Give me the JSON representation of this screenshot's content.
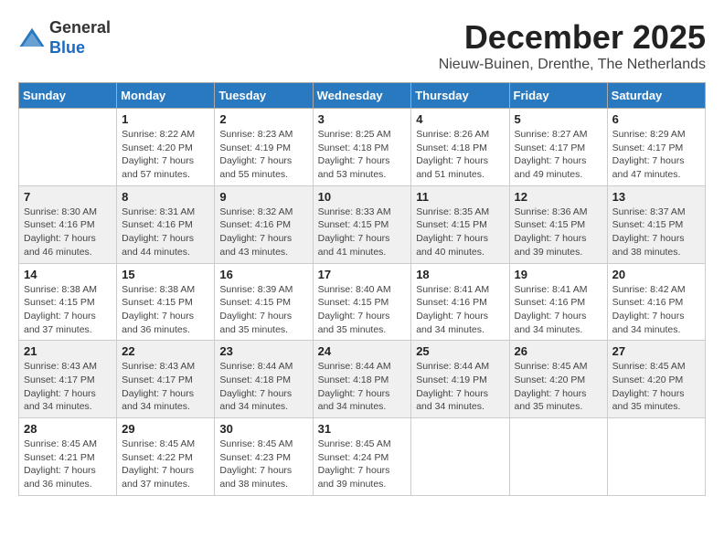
{
  "header": {
    "logo_line1": "General",
    "logo_line2": "Blue",
    "month": "December 2025",
    "location": "Nieuw-Buinen, Drenthe, The Netherlands"
  },
  "weekdays": [
    "Sunday",
    "Monday",
    "Tuesday",
    "Wednesday",
    "Thursday",
    "Friday",
    "Saturday"
  ],
  "weeks": [
    [
      {
        "day": "",
        "sunrise": "",
        "sunset": "",
        "daylight": ""
      },
      {
        "day": "1",
        "sunrise": "Sunrise: 8:22 AM",
        "sunset": "Sunset: 4:20 PM",
        "daylight": "Daylight: 7 hours and 57 minutes."
      },
      {
        "day": "2",
        "sunrise": "Sunrise: 8:23 AM",
        "sunset": "Sunset: 4:19 PM",
        "daylight": "Daylight: 7 hours and 55 minutes."
      },
      {
        "day": "3",
        "sunrise": "Sunrise: 8:25 AM",
        "sunset": "Sunset: 4:18 PM",
        "daylight": "Daylight: 7 hours and 53 minutes."
      },
      {
        "day": "4",
        "sunrise": "Sunrise: 8:26 AM",
        "sunset": "Sunset: 4:18 PM",
        "daylight": "Daylight: 7 hours and 51 minutes."
      },
      {
        "day": "5",
        "sunrise": "Sunrise: 8:27 AM",
        "sunset": "Sunset: 4:17 PM",
        "daylight": "Daylight: 7 hours and 49 minutes."
      },
      {
        "day": "6",
        "sunrise": "Sunrise: 8:29 AM",
        "sunset": "Sunset: 4:17 PM",
        "daylight": "Daylight: 7 hours and 47 minutes."
      }
    ],
    [
      {
        "day": "7",
        "sunrise": "Sunrise: 8:30 AM",
        "sunset": "Sunset: 4:16 PM",
        "daylight": "Daylight: 7 hours and 46 minutes."
      },
      {
        "day": "8",
        "sunrise": "Sunrise: 8:31 AM",
        "sunset": "Sunset: 4:16 PM",
        "daylight": "Daylight: 7 hours and 44 minutes."
      },
      {
        "day": "9",
        "sunrise": "Sunrise: 8:32 AM",
        "sunset": "Sunset: 4:16 PM",
        "daylight": "Daylight: 7 hours and 43 minutes."
      },
      {
        "day": "10",
        "sunrise": "Sunrise: 8:33 AM",
        "sunset": "Sunset: 4:15 PM",
        "daylight": "Daylight: 7 hours and 41 minutes."
      },
      {
        "day": "11",
        "sunrise": "Sunrise: 8:35 AM",
        "sunset": "Sunset: 4:15 PM",
        "daylight": "Daylight: 7 hours and 40 minutes."
      },
      {
        "day": "12",
        "sunrise": "Sunrise: 8:36 AM",
        "sunset": "Sunset: 4:15 PM",
        "daylight": "Daylight: 7 hours and 39 minutes."
      },
      {
        "day": "13",
        "sunrise": "Sunrise: 8:37 AM",
        "sunset": "Sunset: 4:15 PM",
        "daylight": "Daylight: 7 hours and 38 minutes."
      }
    ],
    [
      {
        "day": "14",
        "sunrise": "Sunrise: 8:38 AM",
        "sunset": "Sunset: 4:15 PM",
        "daylight": "Daylight: 7 hours and 37 minutes."
      },
      {
        "day": "15",
        "sunrise": "Sunrise: 8:38 AM",
        "sunset": "Sunset: 4:15 PM",
        "daylight": "Daylight: 7 hours and 36 minutes."
      },
      {
        "day": "16",
        "sunrise": "Sunrise: 8:39 AM",
        "sunset": "Sunset: 4:15 PM",
        "daylight": "Daylight: 7 hours and 35 minutes."
      },
      {
        "day": "17",
        "sunrise": "Sunrise: 8:40 AM",
        "sunset": "Sunset: 4:15 PM",
        "daylight": "Daylight: 7 hours and 35 minutes."
      },
      {
        "day": "18",
        "sunrise": "Sunrise: 8:41 AM",
        "sunset": "Sunset: 4:16 PM",
        "daylight": "Daylight: 7 hours and 34 minutes."
      },
      {
        "day": "19",
        "sunrise": "Sunrise: 8:41 AM",
        "sunset": "Sunset: 4:16 PM",
        "daylight": "Daylight: 7 hours and 34 minutes."
      },
      {
        "day": "20",
        "sunrise": "Sunrise: 8:42 AM",
        "sunset": "Sunset: 4:16 PM",
        "daylight": "Daylight: 7 hours and 34 minutes."
      }
    ],
    [
      {
        "day": "21",
        "sunrise": "Sunrise: 8:43 AM",
        "sunset": "Sunset: 4:17 PM",
        "daylight": "Daylight: 7 hours and 34 minutes."
      },
      {
        "day": "22",
        "sunrise": "Sunrise: 8:43 AM",
        "sunset": "Sunset: 4:17 PM",
        "daylight": "Daylight: 7 hours and 34 minutes."
      },
      {
        "day": "23",
        "sunrise": "Sunrise: 8:44 AM",
        "sunset": "Sunset: 4:18 PM",
        "daylight": "Daylight: 7 hours and 34 minutes."
      },
      {
        "day": "24",
        "sunrise": "Sunrise: 8:44 AM",
        "sunset": "Sunset: 4:18 PM",
        "daylight": "Daylight: 7 hours and 34 minutes."
      },
      {
        "day": "25",
        "sunrise": "Sunrise: 8:44 AM",
        "sunset": "Sunset: 4:19 PM",
        "daylight": "Daylight: 7 hours and 34 minutes."
      },
      {
        "day": "26",
        "sunrise": "Sunrise: 8:45 AM",
        "sunset": "Sunset: 4:20 PM",
        "daylight": "Daylight: 7 hours and 35 minutes."
      },
      {
        "day": "27",
        "sunrise": "Sunrise: 8:45 AM",
        "sunset": "Sunset: 4:20 PM",
        "daylight": "Daylight: 7 hours and 35 minutes."
      }
    ],
    [
      {
        "day": "28",
        "sunrise": "Sunrise: 8:45 AM",
        "sunset": "Sunset: 4:21 PM",
        "daylight": "Daylight: 7 hours and 36 minutes."
      },
      {
        "day": "29",
        "sunrise": "Sunrise: 8:45 AM",
        "sunset": "Sunset: 4:22 PM",
        "daylight": "Daylight: 7 hours and 37 minutes."
      },
      {
        "day": "30",
        "sunrise": "Sunrise: 8:45 AM",
        "sunset": "Sunset: 4:23 PM",
        "daylight": "Daylight: 7 hours and 38 minutes."
      },
      {
        "day": "31",
        "sunrise": "Sunrise: 8:45 AM",
        "sunset": "Sunset: 4:24 PM",
        "daylight": "Daylight: 7 hours and 39 minutes."
      },
      {
        "day": "",
        "sunrise": "",
        "sunset": "",
        "daylight": ""
      },
      {
        "day": "",
        "sunrise": "",
        "sunset": "",
        "daylight": ""
      },
      {
        "day": "",
        "sunrise": "",
        "sunset": "",
        "daylight": ""
      }
    ]
  ]
}
